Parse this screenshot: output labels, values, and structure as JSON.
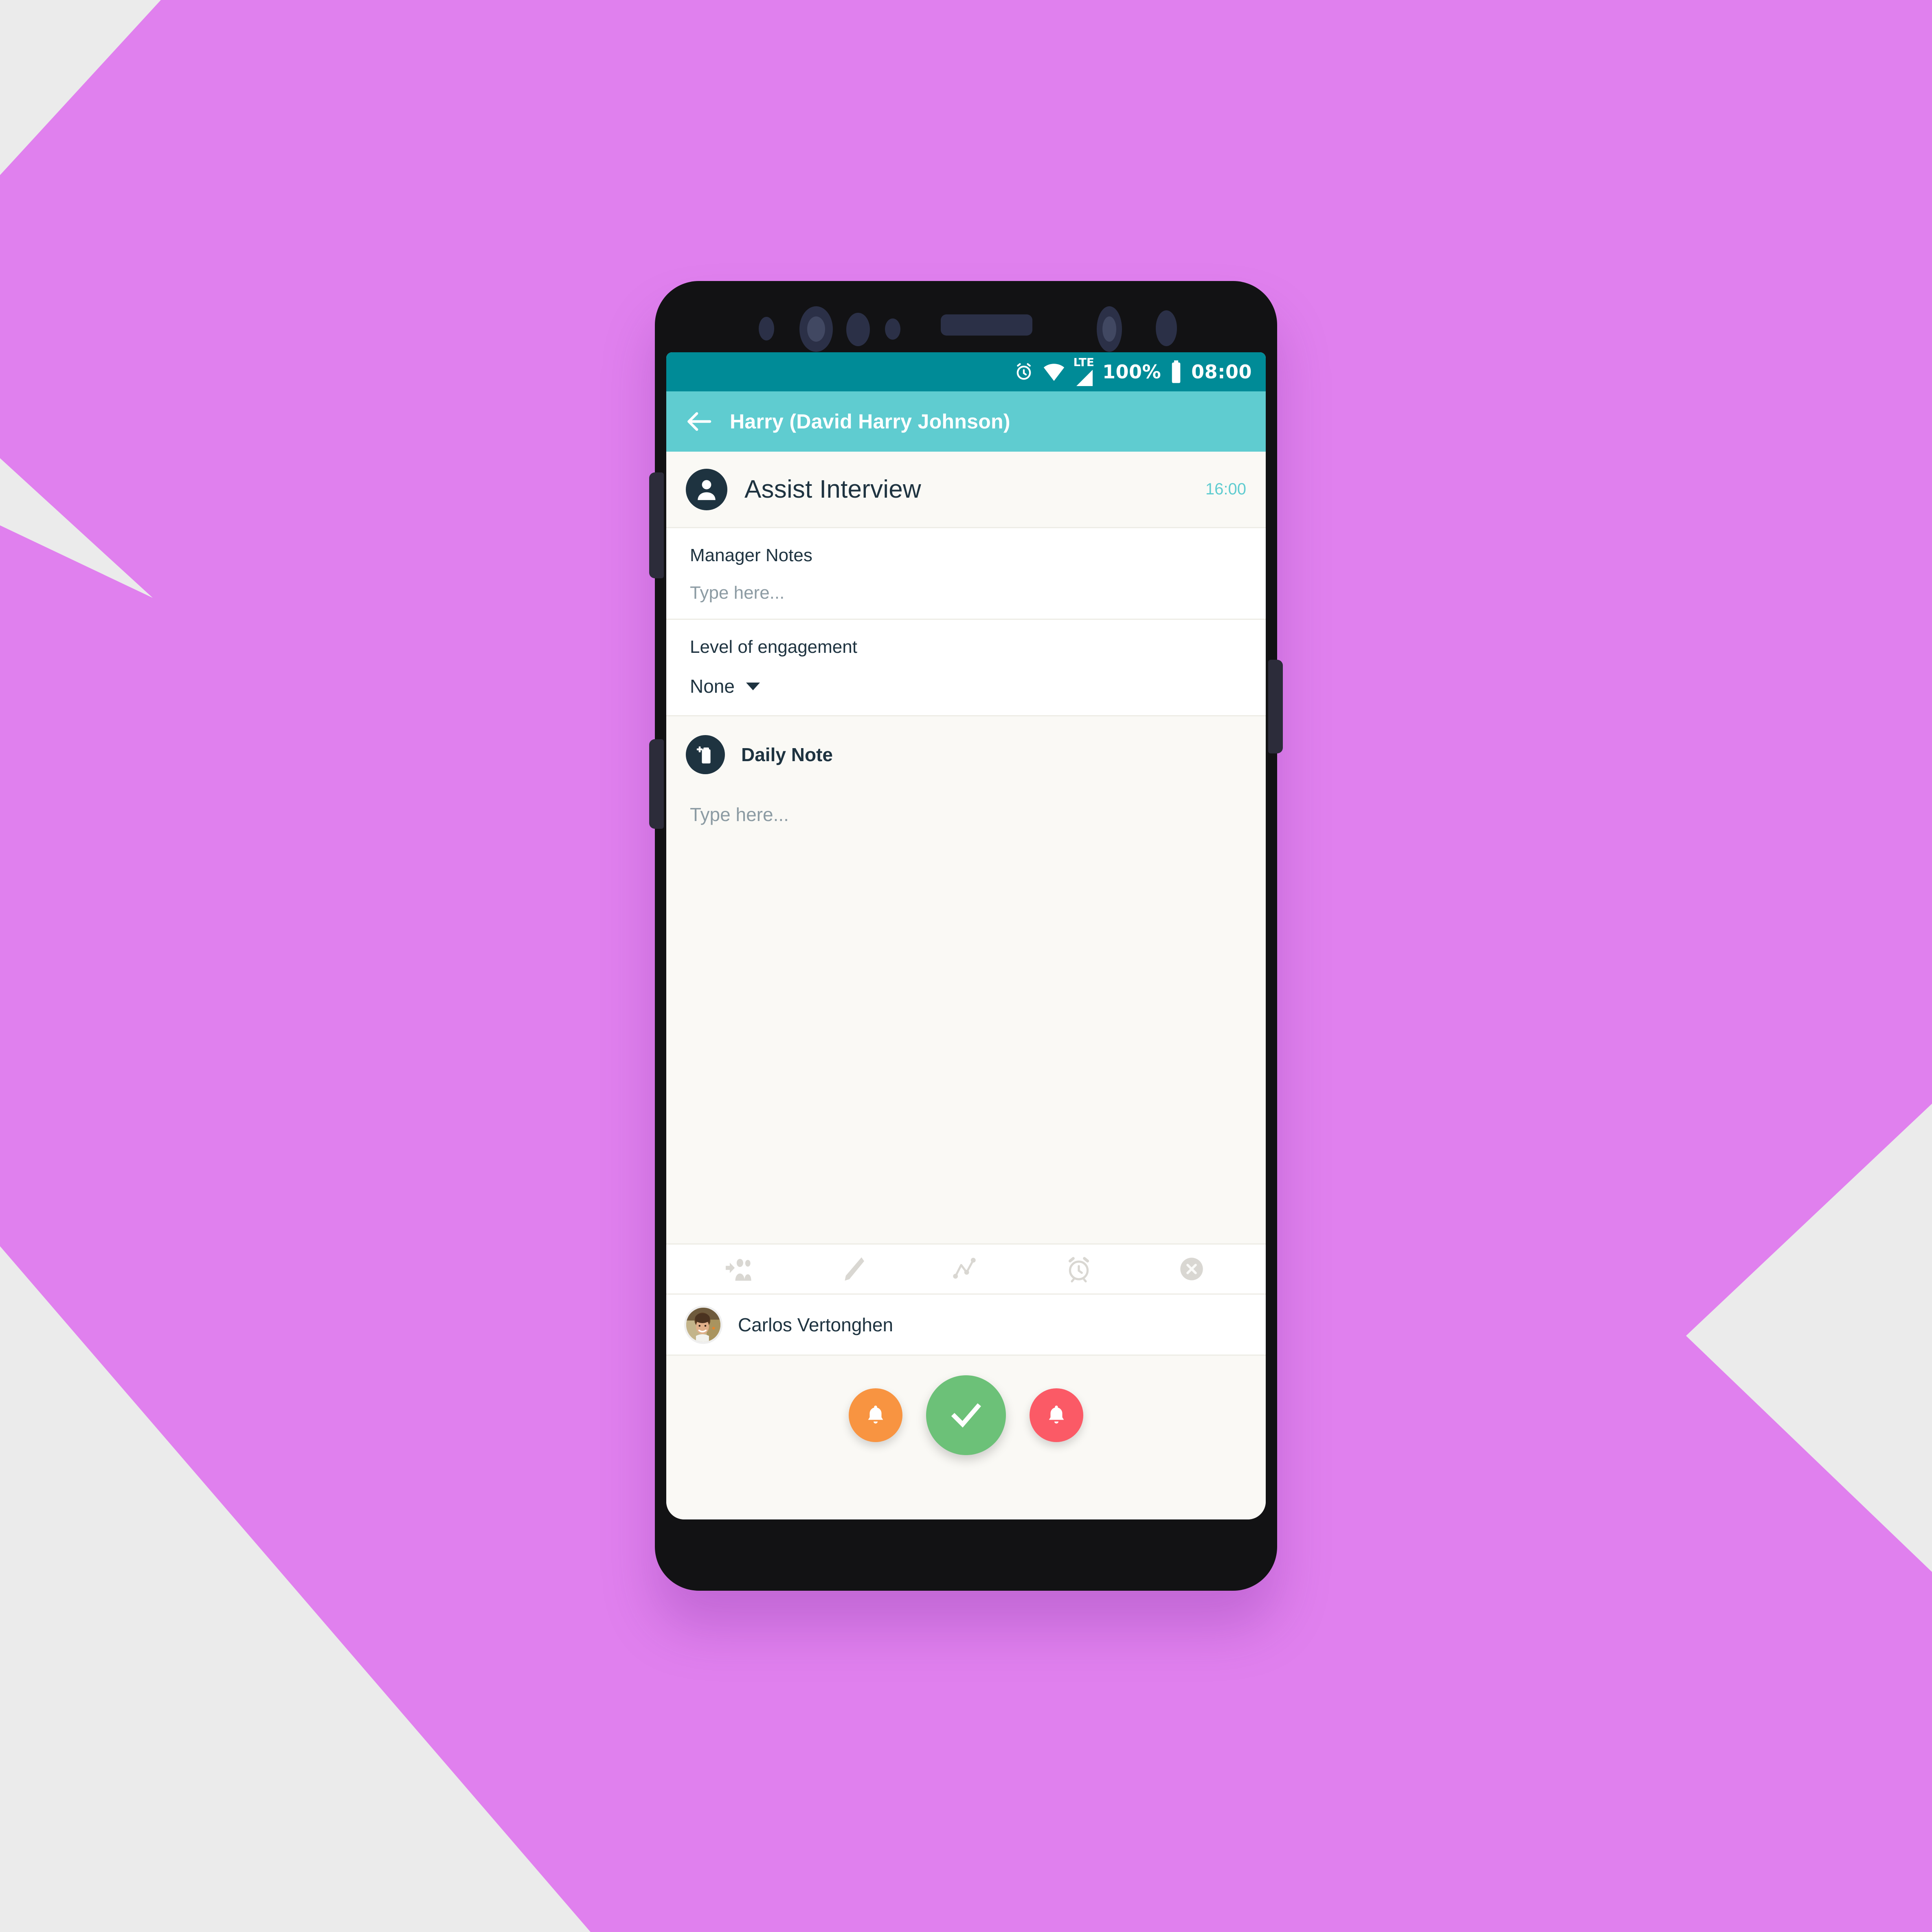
{
  "background": {
    "page_color": "#ebebeb",
    "accent_shape_color": "#e080ee"
  },
  "device": {
    "frame_color": "#121214",
    "sensor_names": [
      "proximity-sensor",
      "front-camera",
      "iris-scanner",
      "led-indicator",
      "earpiece-speaker",
      "front-camera-secondary",
      "light-sensor"
    ],
    "buttons": [
      "volume-rocker",
      "bixby-button",
      "power-button"
    ]
  },
  "statusbar": {
    "background": "#008B97",
    "alarm_icon": "alarm-icon",
    "wifi_icon": "wifi-icon",
    "network_label": "LTE",
    "signal_icon": "signal-icon",
    "battery_percent": "100%",
    "battery_icon": "battery-icon",
    "clock": "08:00"
  },
  "appbar": {
    "background": "#5FCCD0",
    "back_label": "back-arrow",
    "title": "Harry (David Harry Johnson)"
  },
  "interview": {
    "avatar_icon": "person-icon",
    "title": "Assist Interview",
    "time": "16:00",
    "time_color": "#5FCCD0"
  },
  "fields": [
    {
      "name": "manager-notes",
      "label": "Manager Notes",
      "value": "",
      "placeholder": "Type here...",
      "type": "text"
    },
    {
      "name": "level-of-engagement",
      "label": "Level of engagement",
      "value": "None",
      "type": "select",
      "options": [
        "None"
      ]
    }
  ],
  "daily_note": {
    "icon": "note-add-icon",
    "title": "Daily Note",
    "value": "",
    "placeholder": "Type here..."
  },
  "toolbar": {
    "items": [
      {
        "name": "add-people-icon",
        "label": "Add people"
      },
      {
        "name": "edit-pencil-icon",
        "label": "Edit"
      },
      {
        "name": "chart-line-icon",
        "label": "Chart"
      },
      {
        "name": "alarm-clock-icon",
        "label": "Reminder"
      },
      {
        "name": "close-circle-icon",
        "label": "Cancel"
      }
    ]
  },
  "assignee": {
    "avatar": "user-photo",
    "name": "Carlos Vertonghen"
  },
  "actions": [
    {
      "name": "remind-button",
      "icon": "bell-icon",
      "color": "#F89441"
    },
    {
      "name": "confirm-button",
      "icon": "check-icon",
      "color": "#6CC178"
    },
    {
      "name": "cancel-button",
      "icon": "bell-icon",
      "color": "#FB5A66"
    }
  ]
}
